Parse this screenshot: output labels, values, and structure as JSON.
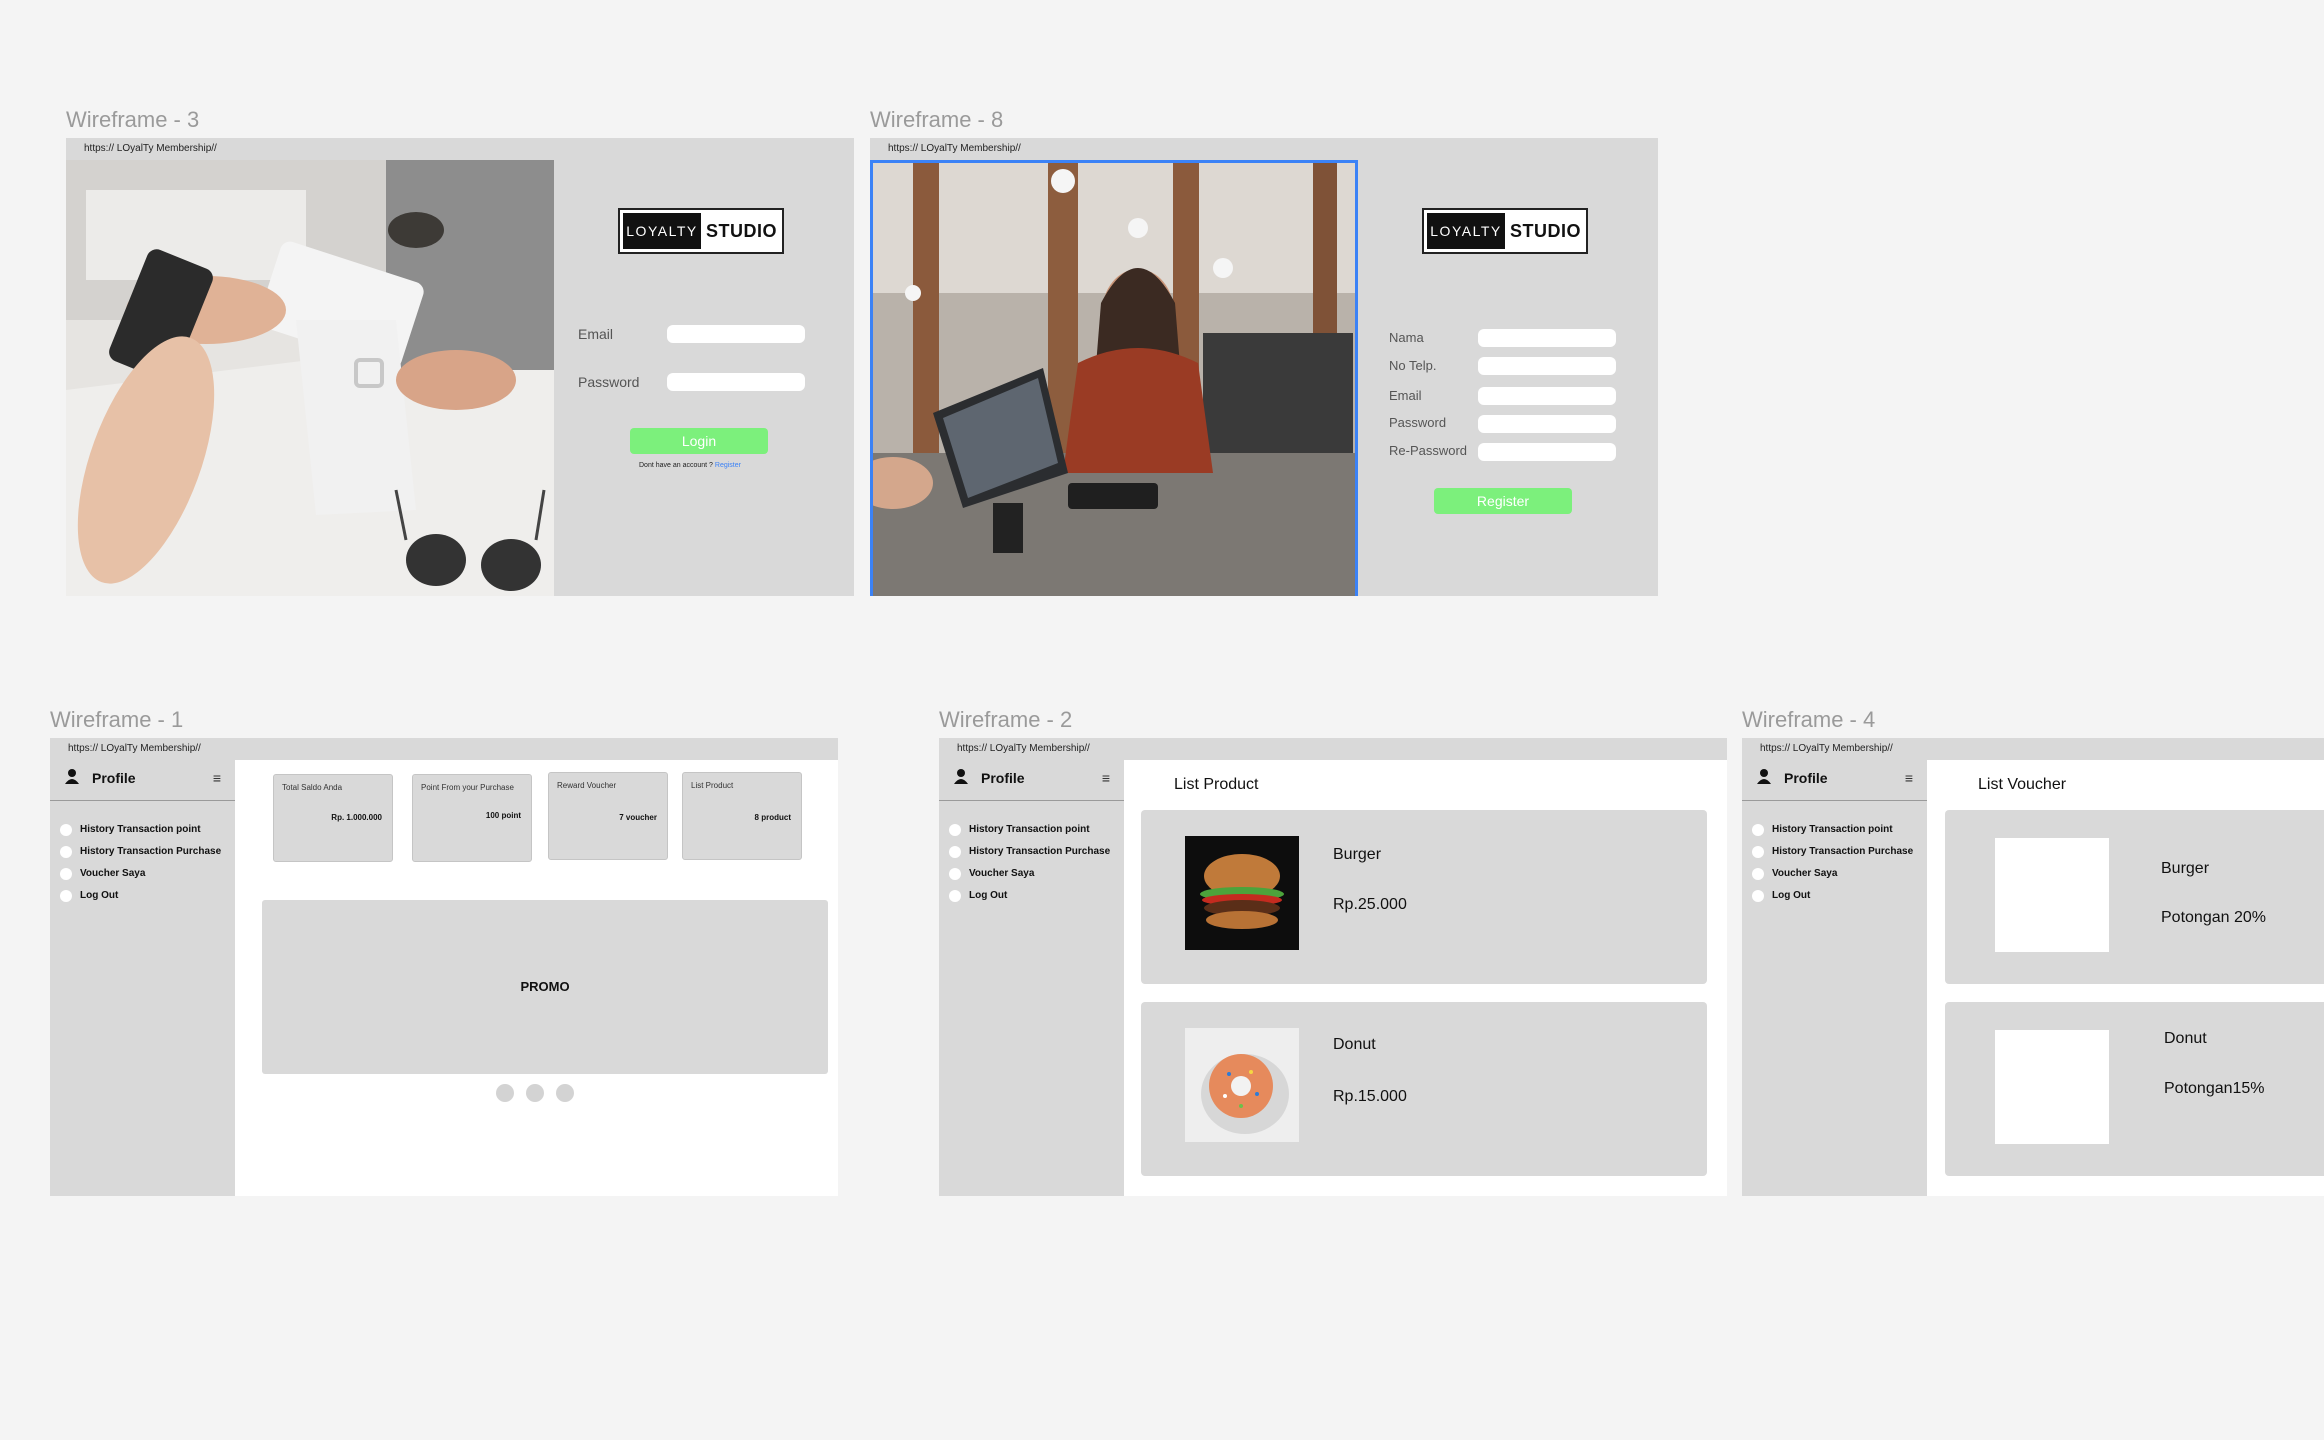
{
  "frames": {
    "wf3": {
      "title": "Wireframe - 3",
      "url": "https:// LOyalTy Membership//",
      "logo": {
        "left": "LOYALTY",
        "right": "STUDIO"
      },
      "email_label": "Email",
      "password_label": "Password",
      "login_button": "Login",
      "no_account_text": "Dont have an account ?",
      "register_link": "Register"
    },
    "wf8": {
      "title": "Wireframe - 8",
      "url": "https:// LOyalTy Membership//",
      "logo": {
        "left": "LOYALTY",
        "right": "STUDIO"
      },
      "fields": [
        "Nama",
        "No Telp.",
        "Email",
        "Password",
        "Re-Password"
      ],
      "register_button": "Register"
    },
    "wf1": {
      "title": "Wireframe - 1",
      "url": "https:// LOyalTy Membership//",
      "profile": "Profile",
      "menu_icon": "≡",
      "nav": [
        "History Transaction point",
        "History Transaction Purchase",
        "Voucher Saya",
        "Log Out"
      ],
      "cards": [
        {
          "title": "Total Saldo Anda",
          "value": "Rp. 1.000.000"
        },
        {
          "title": "Point From your Purchase",
          "value": "100 point"
        },
        {
          "title": "Reward Voucher",
          "value": "7 voucher"
        },
        {
          "title": "List Product",
          "value": "8 product"
        }
      ],
      "promo": "PROMO"
    },
    "wf2": {
      "title": "Wireframe - 2",
      "url": "https:// LOyalTy Membership//",
      "profile": "Profile",
      "menu_icon": "≡",
      "nav": [
        "History Transaction point",
        "History Transaction Purchase",
        "Voucher Saya",
        "Log Out"
      ],
      "heading": "List Product",
      "products": [
        {
          "name": "Burger",
          "price": "Rp.25.000"
        },
        {
          "name": "Donut",
          "price": "Rp.15.000"
        }
      ]
    },
    "wf4": {
      "title": "Wireframe - 4",
      "url": "https:// LOyalTy Membership//",
      "profile": "Profile",
      "menu_icon": "≡",
      "nav": [
        "History Transaction point",
        "History Transaction Purchase",
        "Voucher Saya",
        "Log Out"
      ],
      "heading": "List Voucher",
      "vouchers": [
        {
          "name": "Burger",
          "discount": "Potongan 20%"
        },
        {
          "name": "Donut",
          "discount": "Potongan15%"
        }
      ]
    }
  }
}
